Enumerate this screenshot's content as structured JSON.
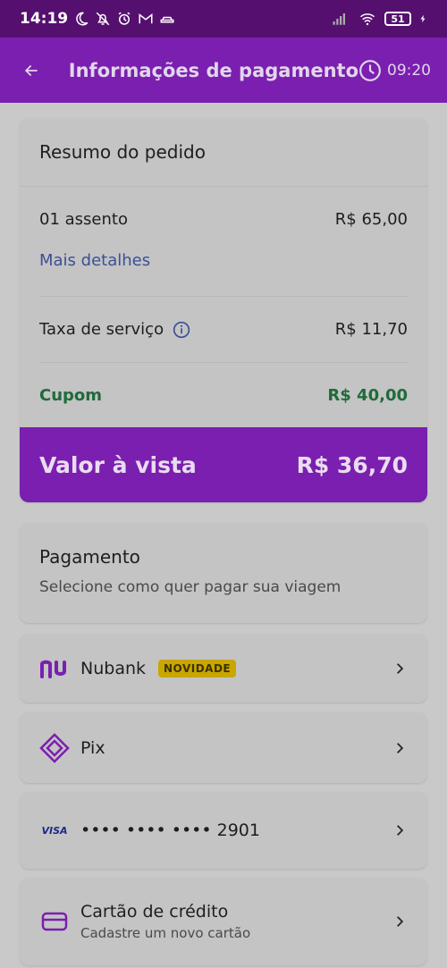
{
  "status_bar": {
    "time": "14:19",
    "battery": "51",
    "icons": [
      "moon-icon",
      "bell-off-icon",
      "alarm-icon",
      "gmail-icon",
      "car-icon",
      "signal-icon",
      "wifi-icon",
      "battery-icon",
      "charging-icon"
    ]
  },
  "app_bar": {
    "title": "Informações de pagamento",
    "timer": "09:20"
  },
  "summary": {
    "title": "Resumo do pedido",
    "seats_label": "01 assento",
    "seats_value": "R$ 65,00",
    "details_link": "Mais detalhes",
    "fee_label": "Taxa de serviço",
    "fee_value": "R$ 11,70",
    "coupon_label": "Cupom",
    "coupon_value": "R$ 40,00",
    "total_label": "Valor à vista",
    "total_value": "R$ 36,70"
  },
  "payment": {
    "title": "Pagamento",
    "subtitle": "Selecione como quer pagar sua viagem",
    "options": {
      "nubank": {
        "label": "Nubank",
        "badge": "NOVIDADE"
      },
      "pix": {
        "label": "Pix"
      },
      "visa": {
        "brand": "VISA",
        "label": "•••• •••• •••• 2901"
      },
      "credit": {
        "label": "Cartão de crédito",
        "sublabel": "Cadastre um novo cartão"
      }
    }
  },
  "colors": {
    "primary": "#7a1fb0",
    "status_bar": "#55106f",
    "coupon_green": "#1e6b3a",
    "link_blue": "#3c4f96",
    "badge_yellow": "#c9a600"
  }
}
